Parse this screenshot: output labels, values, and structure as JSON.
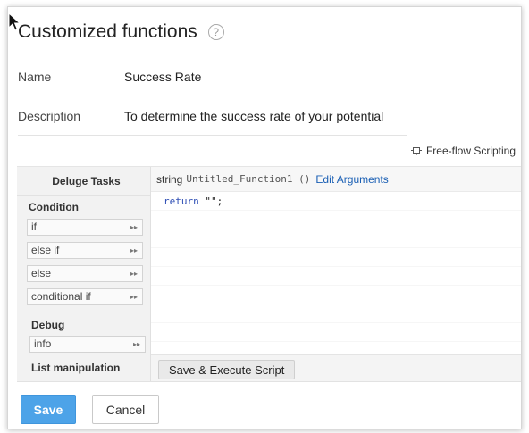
{
  "dialog": {
    "title": "Customized functions",
    "help_icon": "?"
  },
  "form": {
    "name_label": "Name",
    "name_value": "Success Rate",
    "description_label": "Description",
    "description_value": "To determine the success rate of your potential"
  },
  "editor": {
    "mode_toggle": "Free-flow Scripting",
    "mode_icon": "script-mode-icon",
    "tasks_header": "Deluge Tasks",
    "groups": {
      "condition": "Condition",
      "debug": "Debug",
      "list_manipulation": "List manipulation"
    },
    "condition_items": [
      "if",
      "else if",
      "else",
      "conditional if"
    ],
    "debug_items": [
      "info"
    ],
    "item_arrow": "▸▸",
    "signature": {
      "return_type": "string",
      "function_name": "Untitled_Function1 ()",
      "edit_arguments": "Edit Arguments"
    },
    "code": {
      "keyword": "return",
      "rest": " \"\";"
    },
    "execute_button": "Save & Execute Script"
  },
  "actions": {
    "save": "Save",
    "cancel": "Cancel"
  },
  "colors": {
    "primary_button": "#4da3e8",
    "link": "#1a5fb4",
    "code_keyword": "#2f4fb5"
  }
}
